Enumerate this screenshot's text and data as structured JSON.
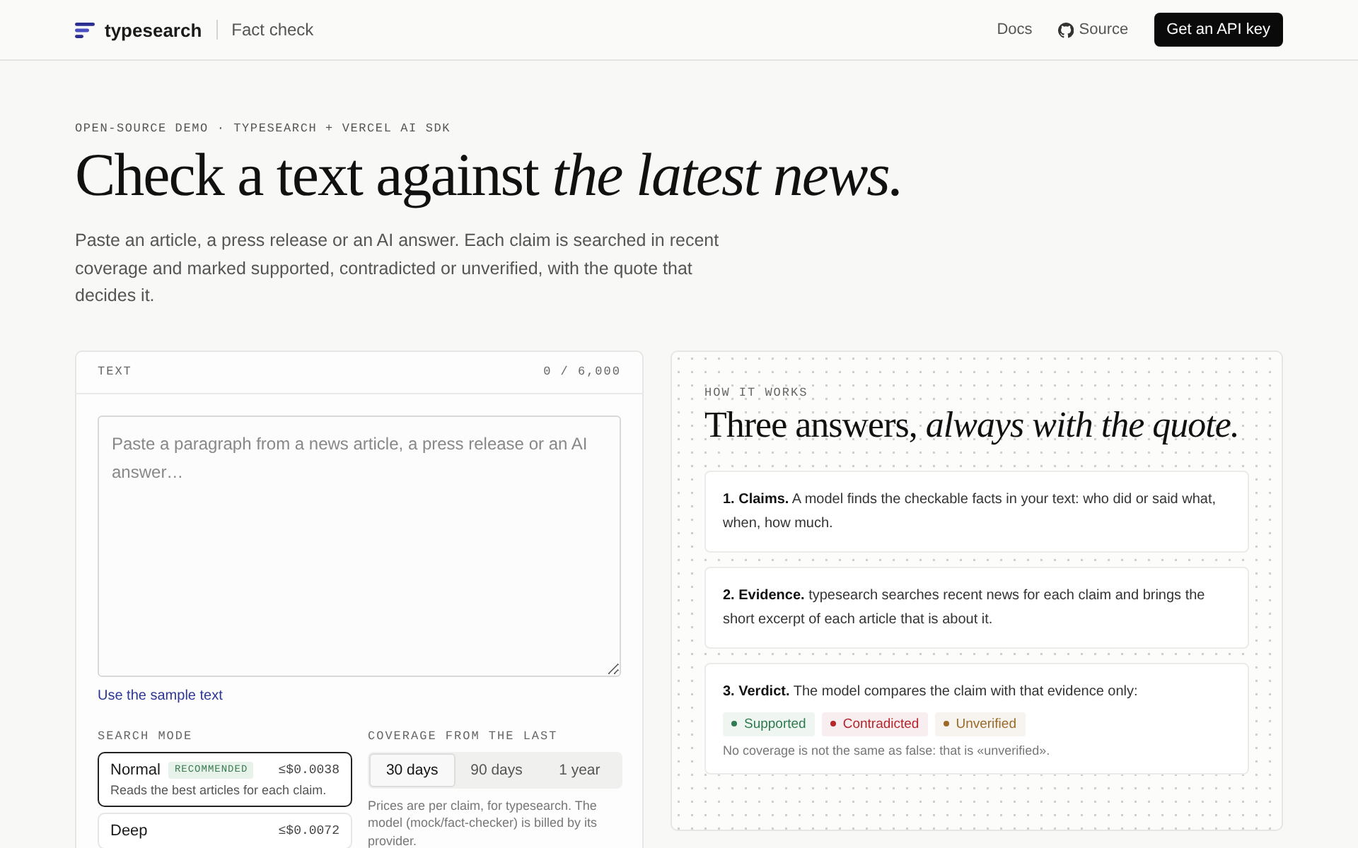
{
  "header": {
    "brand": "typesearch",
    "section": "Fact check",
    "links": [
      {
        "label": "Docs",
        "kind": "text"
      },
      {
        "label": "Source",
        "kind": "github"
      }
    ],
    "cta": "Get an API key"
  },
  "hero": {
    "eyebrow": "OPEN-SOURCE DEMO · TYPESEARCH + VERCEL AI SDK",
    "title": "Check a text against *the latest news.*",
    "lead": "Paste an article, a press release or an AI answer. Each claim is searched in recent coverage and marked supported, contradicted or unverified, with the quote that decides it."
  },
  "input_panel": {
    "label": "TEXT",
    "counter": "0 / 6,000",
    "placeholder": "Paste a paragraph from a news article, a press release or an AI answer…",
    "sample_link": "Use the sample text",
    "search_mode": {
      "label": "SEARCH MODE",
      "options": [
        {
          "name": "Normal",
          "badge": "RECOMMENDED",
          "price": "≤$0.0038",
          "description": "Reads the best articles for each claim.",
          "selected": true
        },
        {
          "name": "Deep",
          "price": "≤$0.0072",
          "selected": false
        }
      ]
    },
    "coverage": {
      "label": "COVERAGE FROM THE LAST",
      "options": [
        {
          "label": "30 days",
          "selected": true
        },
        {
          "label": "90 days",
          "selected": false
        },
        {
          "label": "1 year",
          "selected": false
        }
      ],
      "note": "Prices are per claim, for typesearch. The model (mock/fact-checker) is billed by its provider."
    }
  },
  "how_it_works": {
    "eyebrow": "HOW IT WORKS",
    "title": "Three answers, *always with the quote.*",
    "steps": [
      {
        "text": "**1. Claims.** A model finds the checkable facts in your text: who did or said what, when, how much."
      },
      {
        "text": "**2. Evidence.** typesearch searches recent news for each claim and brings the short excerpt of each article that is about it."
      },
      {
        "text": "**3. Verdict.** The model compares the claim with that evidence only:",
        "verdicts": [
          {
            "label": "Supported",
            "color": "#2f7a4f"
          },
          {
            "label": "Contradicted",
            "color": "#b3262d"
          },
          {
            "label": "Unverified",
            "color": "#9a6a2a"
          }
        ],
        "note": "No coverage is not the same as false: that is «unverified»."
      }
    ]
  }
}
